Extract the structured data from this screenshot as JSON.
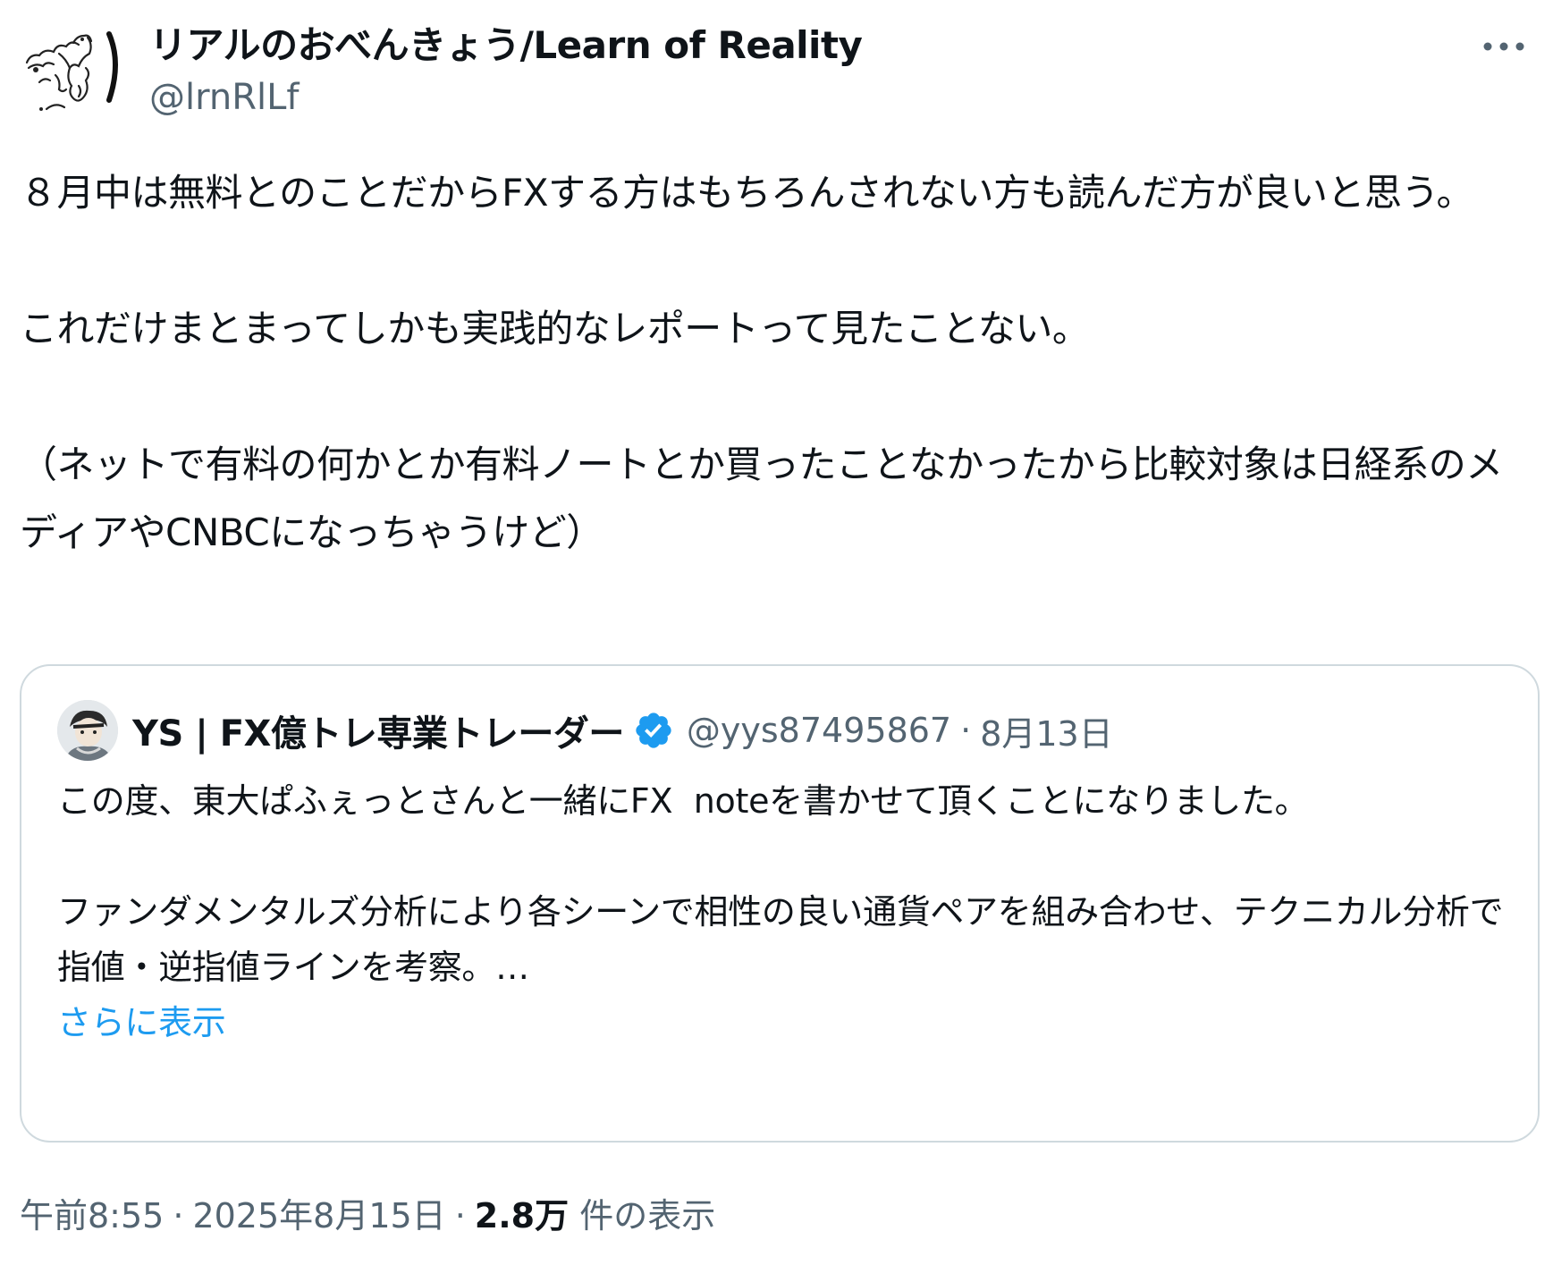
{
  "author": {
    "display_name": "リアルのおべんきょう/Learn of Reality",
    "handle": "@lrnRlLf",
    "avatar_icon": "bird-sketch-avatar-icon"
  },
  "more_icon": "more-horizontal-icon",
  "tweet": {
    "paragraphs": [
      "８月中は無料とのことだからFXする方はもちろんされない方も読んだ方が良いと思う。",
      "これだけまとまってしかも実践的なレポートって見たことない。",
      "（ネットで有料の何かとか有料ノートとか買ったことなかったから比較対象は日経系のメディアやCNBCになっちゃうけど）"
    ]
  },
  "quote": {
    "display_name": "YS | FX億トレ専業トレーダー",
    "verified_icon": "verified-badge-icon",
    "handle": "@yys87495867",
    "separator": "·",
    "date": "8月13日",
    "paragraphs": [
      "この度、東大ぱふぇっとさんと一緒にFX  noteを書かせて頂くことになりました。",
      "ファンダメンタルズ分析により各シーンで相性の良い通貨ペアを組み合わせ、テクニカル分析で指値・逆指値ラインを考察。…"
    ],
    "show_more": "さらに表示",
    "accent_color": "#1d9bf0"
  },
  "meta": {
    "time": "午前8:55",
    "separator": "·",
    "date": "2025年8月15日",
    "views_count": "2.8万",
    "views_label": "件の表示"
  },
  "colors": {
    "text": "#0f1419",
    "secondary": "#536471",
    "border": "#cfd9de",
    "link": "#1d9bf0"
  }
}
